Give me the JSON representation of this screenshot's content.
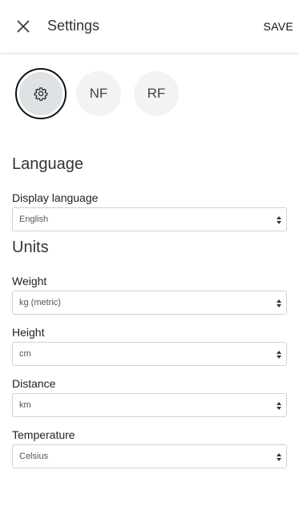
{
  "header": {
    "title": "Settings",
    "save_label": "SAVE"
  },
  "profiles": [
    {
      "label": "",
      "icon": "gear-icon",
      "selected": true
    },
    {
      "label": "NF"
    },
    {
      "label": "RF"
    }
  ],
  "sections": {
    "language": {
      "title": "Language",
      "display_language": {
        "label": "Display language",
        "value": "English"
      }
    },
    "units": {
      "title": "Units",
      "weight": {
        "label": "Weight",
        "value": "kg (metric)"
      },
      "height": {
        "label": "Height",
        "value": "cm"
      },
      "distance": {
        "label": "Distance",
        "value": "km"
      },
      "temperature": {
        "label": "Temperature",
        "value": "Celsius"
      }
    }
  }
}
